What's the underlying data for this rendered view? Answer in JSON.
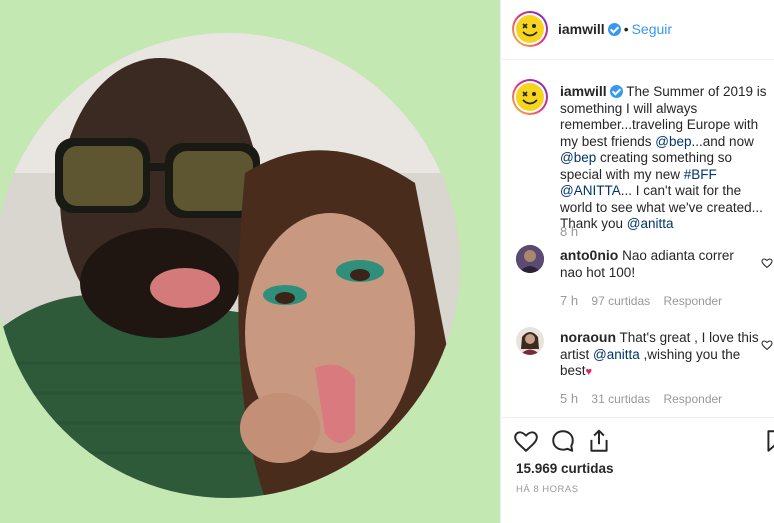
{
  "header": {
    "username": "iamwill",
    "follow_label": "Seguir",
    "separator": "•"
  },
  "caption": {
    "username": "iamwill",
    "text_1": "The Summer of 2019 is something I will always remember...traveling Europe with my best friends ",
    "mention_bep_1": "@bep",
    "text_2": "...and now ",
    "mention_bep_2": "@bep",
    "text_3": " creating something so special with my new ",
    "hashtag_bff": "#BFF",
    "text_4": " ",
    "mention_anitta_1": "@ANITTA",
    "text_5": "... I can't wait for the world to see what we've created... Thank you ",
    "mention_anitta_2": "@anitta",
    "time": "8 h"
  },
  "comments": [
    {
      "username": "anto0nio",
      "text": "Nao adianta correr nao hot 100!",
      "time": "7 h",
      "likes": "97 curtidas",
      "reply": "Responder"
    },
    {
      "username": "noraoun",
      "text_1": "That's great , I love this artist ",
      "mention": "@anitta",
      "text_2": " ,wishing you the best",
      "time": "5 h",
      "likes": "31 curtidas",
      "reply": "Responder"
    }
  ],
  "footer": {
    "likes": "15.969 curtidas",
    "posted_ago": "HÁ 8 HORAS"
  },
  "colors": {
    "background_green": "#c3e8b2",
    "link_blue": "#3897f0",
    "mention_blue": "#003569",
    "muted": "#999999",
    "verified": "#3897f0"
  },
  "icons": [
    "heart-icon",
    "comment-icon",
    "share-icon",
    "bookmark-icon",
    "verified-badge-icon",
    "small-heart-icon"
  ]
}
